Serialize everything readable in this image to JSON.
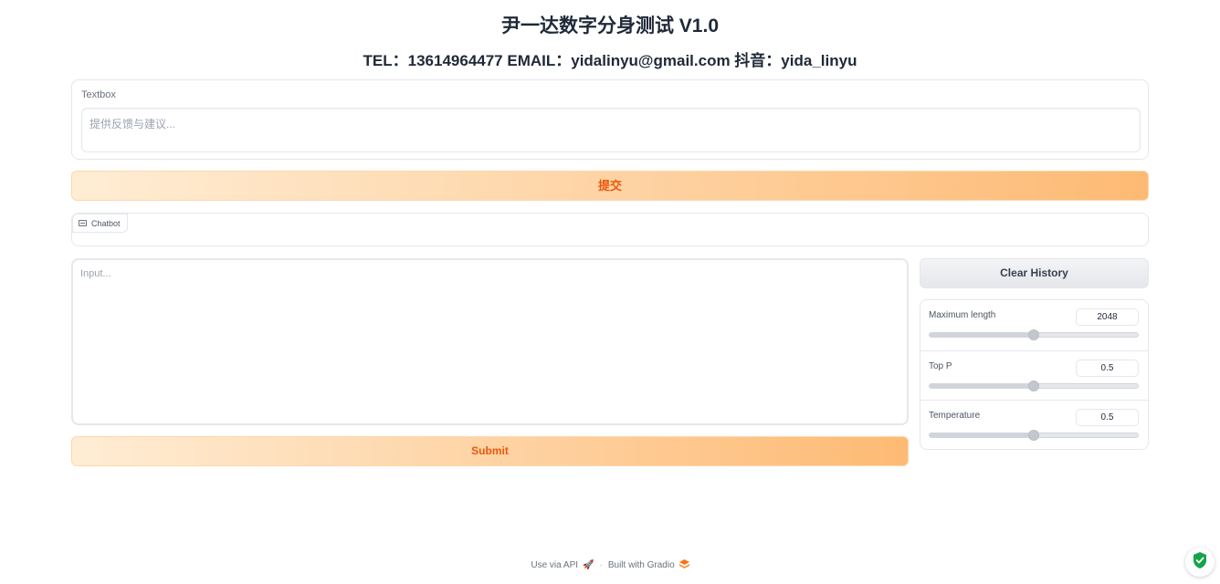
{
  "header": {
    "title": "尹一达数字分身测试 V1.0",
    "subtitle": "TEL：13614964477 EMAIL：yidalinyu@gmail.com 抖音：yida_linyu"
  },
  "feedback": {
    "label": "Textbox",
    "placeholder": "提供反馈与建议...",
    "submit_label": "提交"
  },
  "chatbot": {
    "label": "Chatbot"
  },
  "chat_input": {
    "placeholder": "Input...",
    "submit_label": "Submit"
  },
  "controls": {
    "clear_label": "Clear History",
    "sliders": [
      {
        "label": "Maximum length",
        "value": "2048",
        "fraction": 0.5
      },
      {
        "label": "Top P",
        "value": "0.5",
        "fraction": 0.5
      },
      {
        "label": "Temperature",
        "value": "0.5",
        "fraction": 0.5
      }
    ]
  },
  "footer": {
    "api_label": "Use via API",
    "separator": "·",
    "built_label": "Built with Gradio"
  },
  "colors": {
    "accent": "#ea580c",
    "button_gradient_start": "#ffedd5",
    "button_gradient_end": "#fdba74",
    "shield": "#16a34a"
  }
}
